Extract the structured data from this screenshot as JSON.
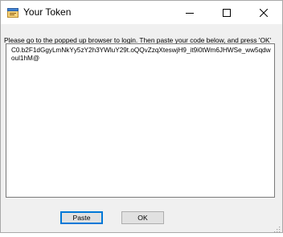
{
  "window": {
    "title": "Your Token"
  },
  "titlebar_buttons": {
    "minimize_icon": "minimize-icon",
    "maximize_icon": "maximize-icon",
    "close_icon": "close-icon"
  },
  "dialog": {
    "instructions": "Please go to the popped up browser to login. Then paste your code below, and press 'OK'",
    "token_value": "C0.b2F1dGgyLmNkYy5zY2h3YWluY29t.oQQvZzqXteswjH9_it9i0tWm6JHWSe_ww5qdwoul1hM@",
    "paste_label": "Paste",
    "ok_label": "OK"
  },
  "colors": {
    "accent": "#0078d7",
    "dialog_bg": "#f0f0f0",
    "titlebar_bg": "#ffffff"
  }
}
